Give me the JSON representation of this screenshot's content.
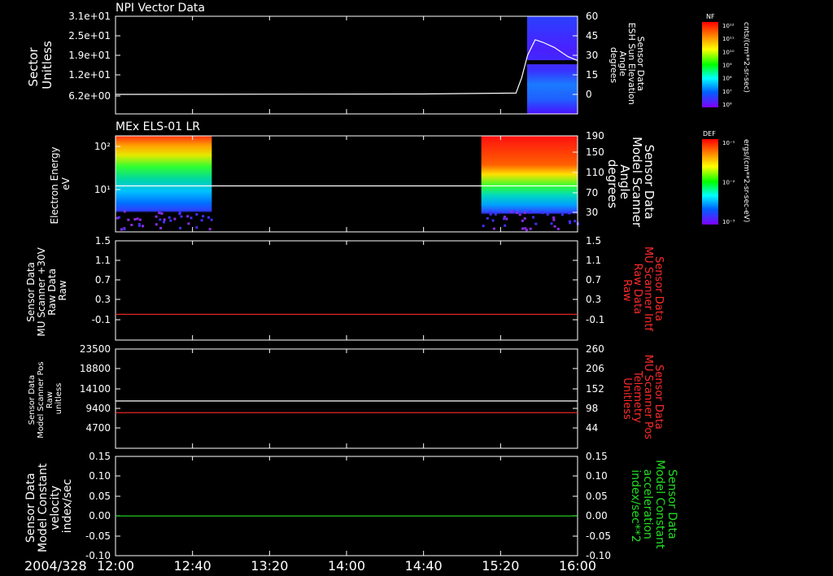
{
  "colors": {
    "background": "#000000",
    "foreground": "#ffffff",
    "red_trace": "#ff2a2a",
    "green_trace": "#22dd22"
  },
  "time_axis": {
    "date_label": "2004/328",
    "ticks": [
      "12:00",
      "12:40",
      "13:20",
      "14:00",
      "14:40",
      "15:20",
      "16:00"
    ]
  },
  "colorbars": [
    {
      "title": "NF",
      "unit": "cnts/(cm**2-sr-sec)",
      "tick_labels": [
        "10¹²",
        "10¹¹",
        "10¹⁰",
        "10⁹",
        "10⁸",
        "10⁷",
        "10⁶"
      ]
    },
    {
      "title": "DEF",
      "unit": "ergs/(cm**2-sr-sec-eV)",
      "tick_labels": [
        "10⁻¹",
        "10⁻²",
        "10⁻³"
      ]
    }
  ],
  "chart_data": [
    {
      "type": "line",
      "title": "NPI Vector Data",
      "left_label": [
        "Sector",
        "Unitless"
      ],
      "right_label": [
        "Sensor Data",
        "ESH Sun Elevation",
        "Angle",
        "degrees"
      ],
      "left_ticks": [
        "3.1e+01",
        "2.5e+01",
        "1.9e+01",
        "1.2e+01",
        "6.2e+00"
      ],
      "right_ticks": [
        "60",
        "45",
        "30",
        "15",
        "0"
      ],
      "right_ylim": [
        -15,
        60
      ],
      "heatmap_x_range": [
        "15:35",
        "16:00"
      ],
      "series": [
        {
          "axis": "right",
          "x": [
            "12:00",
            "14:40",
            "15:28",
            "15:31",
            "15:34",
            "15:38",
            "15:42",
            "15:48",
            "15:55",
            "16:00"
          ],
          "values": [
            0,
            0.3,
            1,
            13,
            30,
            42,
            40,
            36,
            29,
            26
          ]
        }
      ]
    },
    {
      "type": "heatmap",
      "title": "MEx ELS-01 LR",
      "left_label": [
        "Electron Energy",
        "eV"
      ],
      "right_label": [
        "Sensor Data",
        "Model Scanner",
        "Angle",
        "degrees"
      ],
      "left_ticks": [
        "10²",
        "10¹"
      ],
      "right_ticks": [
        "190",
        "150",
        "110",
        "70",
        "30"
      ],
      "right_ylim": [
        0,
        190
      ],
      "data_blocks": [
        {
          "start": "12:00",
          "end": "12:50"
        },
        {
          "start": "15:10",
          "end": "16:00"
        }
      ],
      "series": [
        {
          "axis": "right",
          "x": [
            "12:00",
            "16:00"
          ],
          "values": [
            91,
            91
          ]
        }
      ]
    },
    {
      "type": "line",
      "left_label": [
        "Sensor Data",
        "MU Scanner +30V",
        "Raw Data",
        "Raw"
      ],
      "right_label": [
        "Sensor Data",
        "MU Scanner Intf",
        "Raw Data",
        "Raw"
      ],
      "right_label_color": "#ff2a2a",
      "left_ticks": [
        "1.5",
        "1.1",
        "0.7",
        "0.3",
        "-0.1"
      ],
      "right_ticks": [
        "1.5",
        "1.1",
        "0.7",
        "0.3",
        "-0.1"
      ],
      "ylim": [
        -0.5,
        1.5
      ],
      "series": [
        {
          "color": "#ff2a2a",
          "x": [
            "12:00",
            "16:00"
          ],
          "values": [
            0.02,
            0.02
          ]
        }
      ]
    },
    {
      "type": "line",
      "left_label": [
        "Sensor Data",
        "Model Scanner Pos",
        "Raw",
        "unitless"
      ],
      "right_label": [
        "Sensor Data",
        "MU Scanner Pos",
        "Telemetry",
        "Unitless"
      ],
      "right_label_color": "#ff2a2a",
      "left_ticks": [
        "23500",
        "18800",
        "14100",
        "9400",
        "4700"
      ],
      "right_ticks": [
        "260",
        "206",
        "152",
        "98",
        "44"
      ],
      "left_ylim": [
        0,
        23500
      ],
      "right_ylim": [
        -10,
        260
      ],
      "series": [
        {
          "color": "#ffffff",
          "axis": "left",
          "x": [
            "12:00",
            "16:00"
          ],
          "values": [
            11200,
            11200
          ]
        },
        {
          "color": "#ff2a2a",
          "axis": "right",
          "x": [
            "12:00",
            "16:00"
          ],
          "values": [
            87,
            87
          ]
        }
      ]
    },
    {
      "type": "line",
      "left_label": [
        "Sensor Data",
        "Model Constant",
        "velocity",
        "index/sec"
      ],
      "right_label": [
        "Sensor Data",
        "Model Constant",
        "acceleration",
        "index/sec**2"
      ],
      "right_label_color": "#22dd22",
      "left_ticks": [
        "0.15",
        "0.10",
        "0.05",
        "0.00",
        "-0.05",
        "-0.10"
      ],
      "right_ticks": [
        "0.15",
        "0.10",
        "0.05",
        "0.00",
        "-0.05",
        "-0.10"
      ],
      "ylim": [
        -0.1,
        0.15
      ],
      "series": [
        {
          "color": "#22dd22",
          "x": [
            "12:00",
            "16:00"
          ],
          "values": [
            0,
            0
          ]
        }
      ]
    }
  ]
}
